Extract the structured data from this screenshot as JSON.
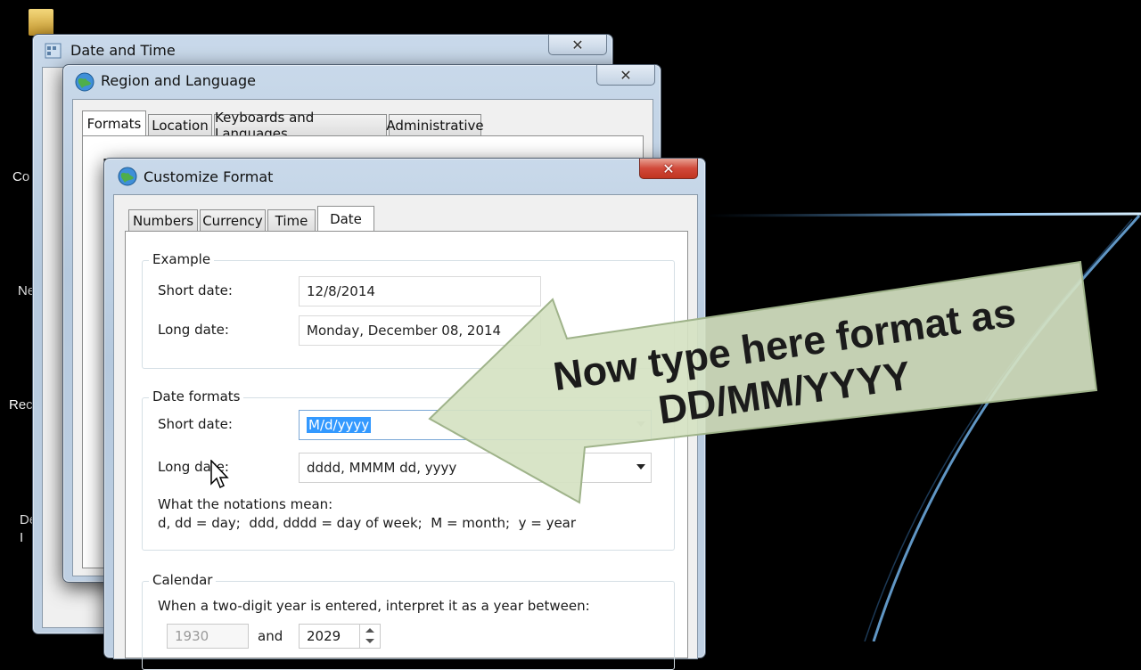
{
  "desktop": {
    "icon_labels": [
      "Co",
      "Ne",
      "Rec",
      "De\nI"
    ]
  },
  "date_time_window": {
    "title": "Date and Time"
  },
  "region_window": {
    "title": "Region and Language",
    "tabs": [
      "Formats",
      "Location",
      "Keyboards and Languages",
      "Administrative"
    ],
    "partial_label": "F"
  },
  "customize_window": {
    "title": "Customize Format",
    "tabs": [
      "Numbers",
      "Currency",
      "Time",
      "Date"
    ],
    "active_tab": "Date",
    "example": {
      "legend": "Example",
      "short_label": "Short date:",
      "short_value": "12/8/2014",
      "long_label": "Long date:",
      "long_value": "Monday, December 08, 2014"
    },
    "formats": {
      "legend": "Date formats",
      "short_label": "Short date:",
      "short_value": "M/d/yyyy",
      "long_label": "Long date:",
      "long_value": "dddd, MMMM dd, yyyy",
      "notation_title": "What the notations mean:",
      "notation_text": "d, dd = day;  ddd, dddd = day of week;  M = month;  y = year"
    },
    "calendar": {
      "legend": "Calendar",
      "instruction": "When a two-digit year is entered, interpret it as a year between:",
      "start_year": "1930",
      "and_label": "and",
      "end_year": "2029"
    }
  },
  "callout": {
    "line1": "Now type here format as",
    "line2": "DD/MM/YYYY",
    "fill_color": "#d5e2c2"
  }
}
